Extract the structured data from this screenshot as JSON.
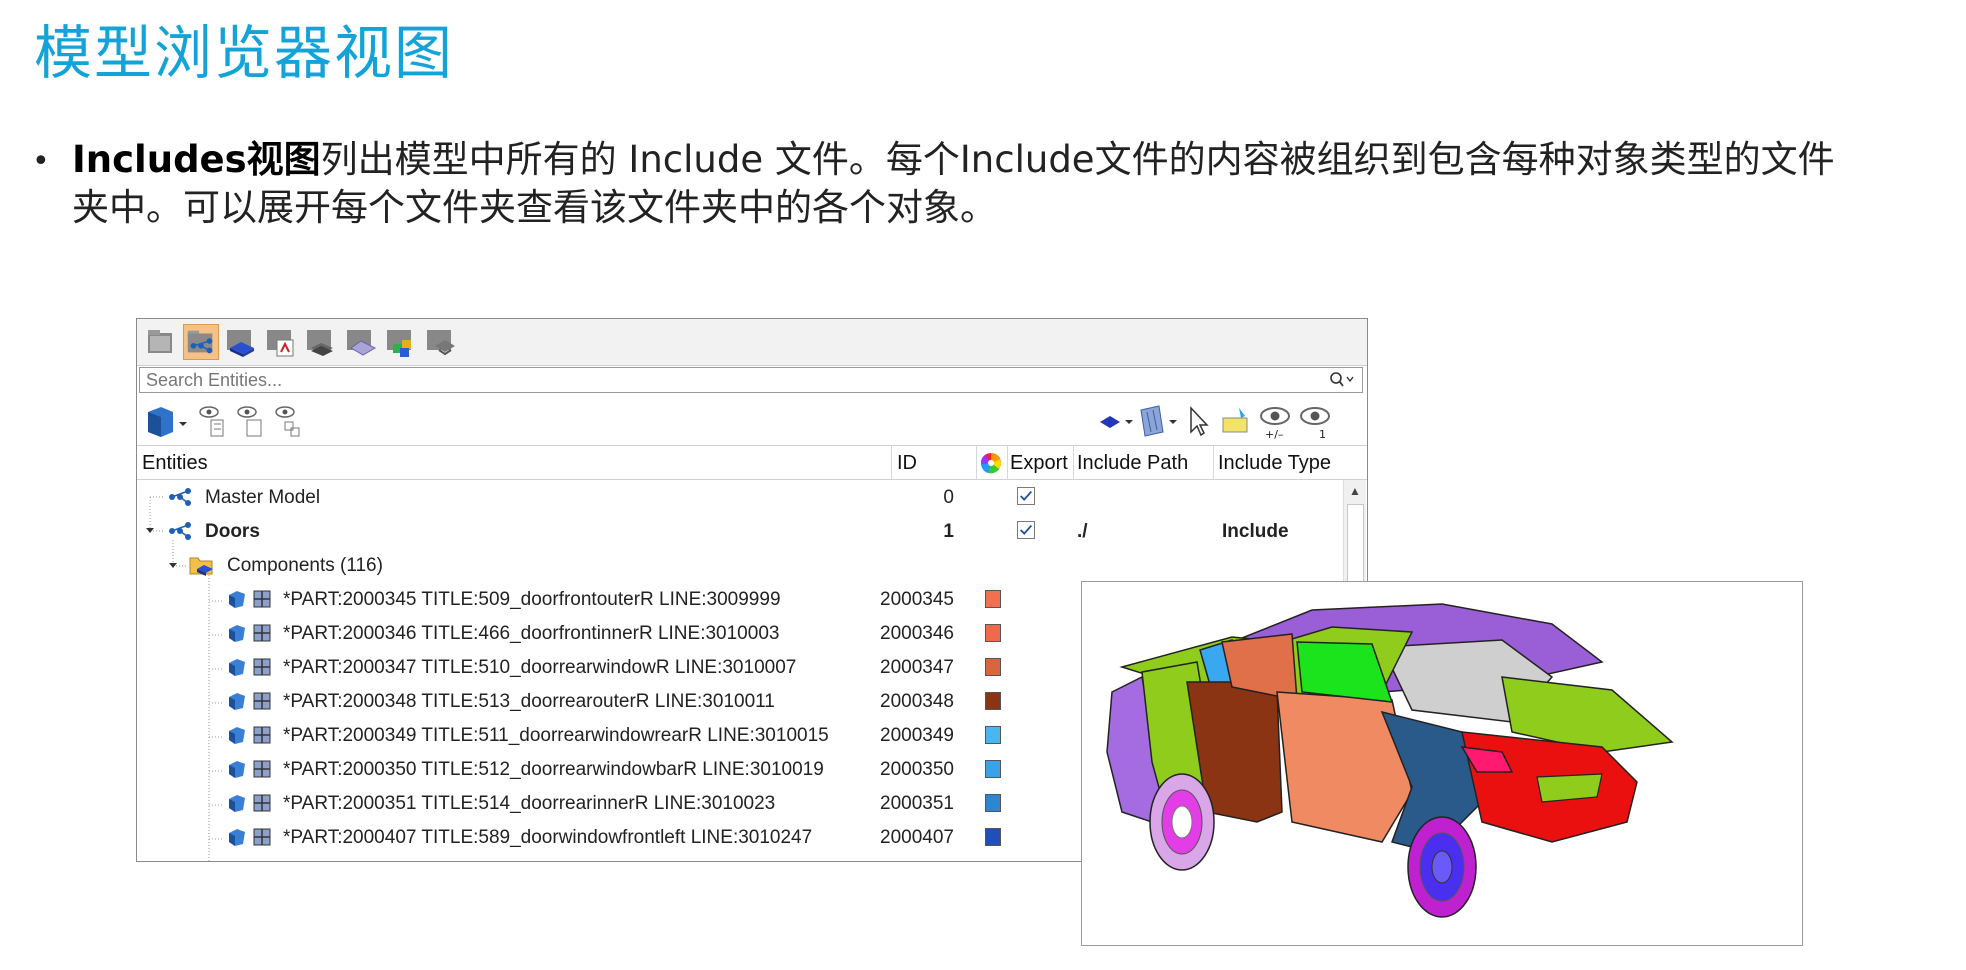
{
  "slide": {
    "title": "模型浏览器视图",
    "bullet_bold": "Includes视图",
    "bullet_line1": "列出模型中所有的 Include 文件。每个Include文件的内容被组织到包含每种对象类型的文件",
    "bullet_line2": "夹中。可以展开每个文件夹查看该文件夹中的各个对象。"
  },
  "browser": {
    "tabs": [
      "model-view-icon",
      "includes-view-icon",
      "component-view-icon",
      "connector-view-icon",
      "assembly-view-icon",
      "material-view-icon",
      "parts-view-icon",
      "subsystem-view-icon"
    ],
    "selected_tab": "includes-view-icon",
    "search": {
      "placeholder": "Search Entities..."
    },
    "columns": {
      "entities": "Entities",
      "id": "ID",
      "export": "Export",
      "include_path": "Include Path",
      "include_type": "Include Type"
    },
    "rows": [
      {
        "label": "Master Model",
        "id": "0",
        "export": true,
        "path": "",
        "type": "",
        "bold": false
      },
      {
        "label": "Doors",
        "id": "1",
        "export": true,
        "path": "./",
        "type": "Include",
        "bold": true
      },
      {
        "label": "Components (116)",
        "id": "",
        "bold": false
      },
      {
        "label": "*PART:2000345 TITLE:509_doorfrontouterR LINE:3009999",
        "id": "2000345",
        "color": "#f07050"
      },
      {
        "label": "*PART:2000346 TITLE:466_doorfrontinnerR LINE:3010003",
        "id": "2000346",
        "color": "#f06a4a"
      },
      {
        "label": "*PART:2000347 TITLE:510_doorrearwindowR LINE:3010007",
        "id": "2000347",
        "color": "#d9653f"
      },
      {
        "label": "*PART:2000348 TITLE:513_doorrearouterR LINE:3010011",
        "id": "2000348",
        "color": "#8b3414"
      },
      {
        "label": "*PART:2000349 TITLE:511_doorrearwindowrearR LINE:3010015",
        "id": "2000349",
        "color": "#48b6f0"
      },
      {
        "label": "*PART:2000350 TITLE:512_doorrearwindowbarR LINE:3010019",
        "id": "2000350",
        "color": "#3aa2e6"
      },
      {
        "label": "*PART:2000351 TITLE:514_doorrearinnerR LINE:3010023",
        "id": "2000351",
        "color": "#2e86d0"
      },
      {
        "label": "*PART:2000407 TITLE:589_doorwindowfrontleft LINE:3010247",
        "id": "2000407",
        "color": "#1f4fb8"
      }
    ]
  },
  "viewport": {
    "content": "car-model-icon"
  }
}
